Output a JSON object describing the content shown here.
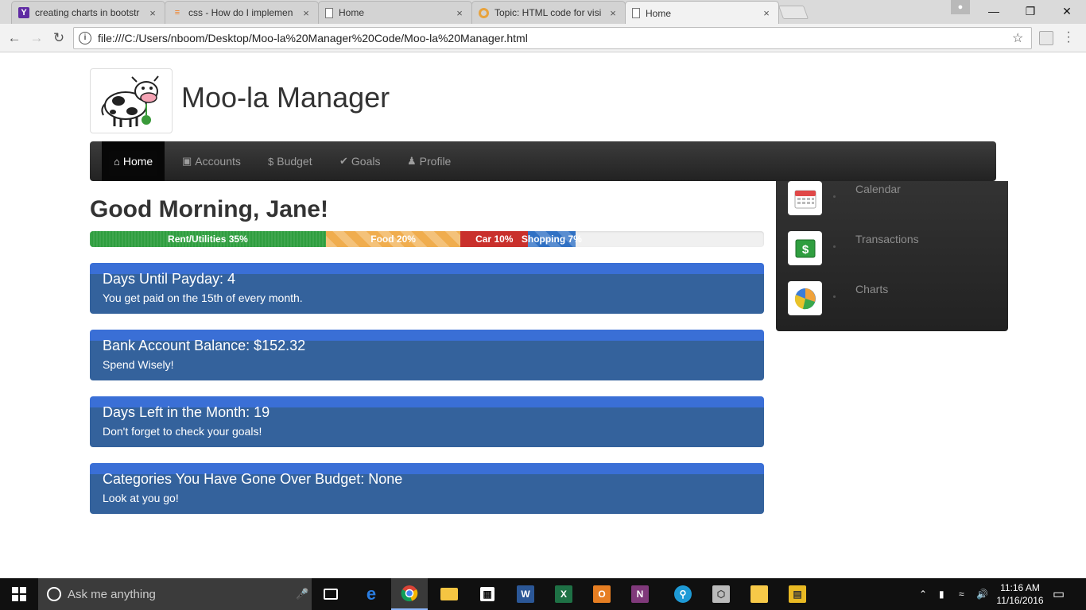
{
  "browser": {
    "tabs": [
      {
        "title": "creating charts in bootstr",
        "favicon": "yahoo-icon"
      },
      {
        "title": "css - How do I implemen",
        "favicon": "stackoverflow-icon"
      },
      {
        "title": "Home",
        "favicon": "document-icon"
      },
      {
        "title": "Topic: HTML code for visi",
        "favicon": "ring-icon"
      },
      {
        "title": "Home",
        "favicon": "document-icon"
      }
    ],
    "close_glyph": "×",
    "url": "file:///C:/Users/nboom/Desktop/Moo-la%20Manager%20Code/Moo-la%20Manager.html"
  },
  "app": {
    "title": "Moo-la Manager"
  },
  "nav": {
    "items": [
      {
        "label": "Home",
        "icon": "home-icon"
      },
      {
        "label": "Accounts",
        "icon": "briefcase-icon"
      },
      {
        "label": "Budget",
        "icon": "dollar-icon"
      },
      {
        "label": "Goals",
        "icon": "check-icon"
      },
      {
        "label": "Profile",
        "icon": "user-icon"
      }
    ]
  },
  "greeting": "Good Morning, Jane!",
  "budget_bar": {
    "segments": [
      {
        "label": "Rent/Utilities 35%",
        "percent": 35,
        "color": "#2f9e3f"
      },
      {
        "label": "Food 20%",
        "percent": 20,
        "color": "#f0ad4e"
      },
      {
        "label": "Car 10%",
        "percent": 10,
        "color": "#c9302c"
      },
      {
        "label": "Shopping 7%",
        "percent": 7,
        "color": "#3071c4"
      }
    ]
  },
  "panels": [
    {
      "heading": "Days Until Payday: 4",
      "body": "You get paid on the 15th of every month."
    },
    {
      "heading": "Bank Account Balance: $152.32",
      "body": "Spend Wisely!"
    },
    {
      "heading": "Days Left in the Month: 19",
      "body": "Don't forget to check your goals!"
    },
    {
      "heading": "Categories You Have Gone Over Budget: None",
      "body": "Look at you go!"
    }
  ],
  "side_menu": {
    "items": [
      {
        "label": "Calendar",
        "icon": "calendar-icon"
      },
      {
        "label": "Transactions",
        "icon": "dollar-bill-icon"
      },
      {
        "label": "Charts",
        "icon": "pie-chart-icon"
      }
    ]
  },
  "taskbar": {
    "search_placeholder": "Ask me anything",
    "time": "11:16 AM",
    "date": "11/16/2016"
  },
  "colors": {
    "panel_blue": "#34629c",
    "navbar_dark": "#222222",
    "accent_green": "#2f9e3f"
  }
}
